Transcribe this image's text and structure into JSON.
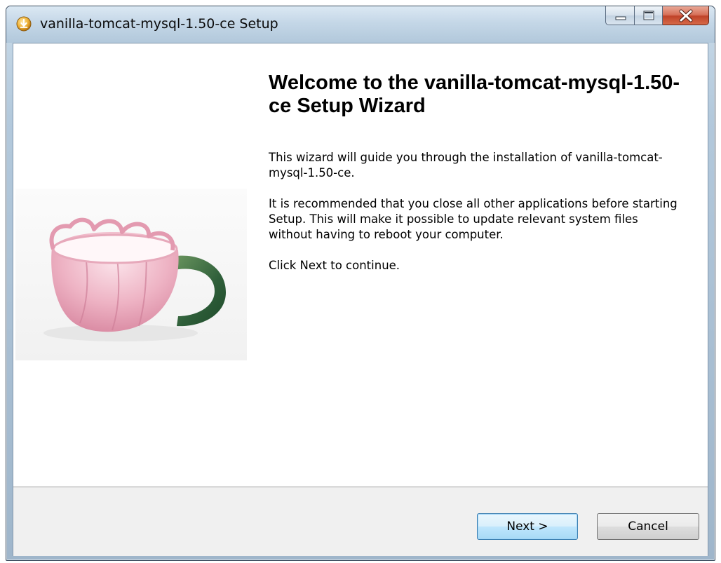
{
  "window": {
    "title": "vanilla-tomcat-mysql-1.50-ce Setup",
    "title_icon": "installer-icon"
  },
  "caption_buttons": {
    "minimize": "minimize-icon",
    "maximize": "maximize-icon",
    "close": "close-icon"
  },
  "welcome": {
    "heading": "Welcome to the vanilla-tomcat-mysql-1.50-ce Setup Wizard",
    "paragraphs": [
      "This wizard will guide you through the installation of vanilla-tomcat-mysql-1.50-ce.",
      "It is recommended that you close all other applications before starting Setup. This will make it possible to update relevant system files without having to reboot your computer.",
      "Click Next to continue."
    ]
  },
  "footer": {
    "next_label": "Next >",
    "cancel_label": "Cancel"
  },
  "colors": {
    "default_button_border": "#3c7fb1",
    "close_button": "#c0442a",
    "footer_background": "#f0f0f0"
  }
}
